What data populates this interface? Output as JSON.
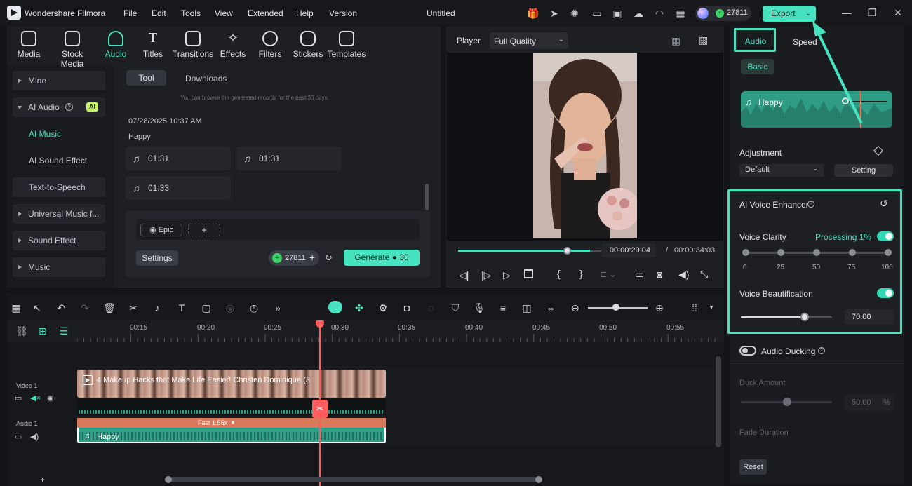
{
  "app": {
    "title": "Wondershare Filmora",
    "doc_title": "Untitled"
  },
  "menu": [
    "File",
    "Edit",
    "Tools",
    "View",
    "Extended",
    "Help",
    "Version"
  ],
  "credits": "27811",
  "export_label": "Export",
  "toolbar": [
    "Media",
    "Stock Media",
    "Audio",
    "Titles",
    "Transitions",
    "Effects",
    "Filters",
    "Stickers",
    "Templates"
  ],
  "sidebar": {
    "mine": "Mine",
    "ai_audio": "AI Audio",
    "ai_badge": "AI",
    "ai_music": "AI Music",
    "ai_sfx": "AI Sound Effect",
    "tts": "Text-to-Speech",
    "universal": "Universal Music f...",
    "sound_effect": "Sound Effect",
    "music": "Music"
  },
  "library": {
    "tab_tool": "Tool",
    "tab_downloads": "Downloads",
    "note": "You can browse the generated records for the past 30 days.",
    "date": "07/28/2025 10:37 AM",
    "group": "Happy",
    "tracks": [
      "01:31",
      "01:31",
      "01:33"
    ],
    "tag_epic": "Epic",
    "tag_add": "+",
    "settings": "Settings",
    "credits": "27811",
    "generate": "Generate",
    "generate_cost": "30"
  },
  "player": {
    "label": "Player",
    "quality": "Full Quality",
    "current": "00:00:29:04",
    "sep": "/",
    "total": "00:00:34:03",
    "progress": 0.86
  },
  "props": {
    "tab_audio": "Audio",
    "tab_speed": "Speed",
    "basic": "Basic",
    "clip_name": "Happy",
    "adjustment": "Adjustment",
    "preset": "Default",
    "setting": "Setting",
    "enhancer_title": "AI Voice Enhancer",
    "voice_clarity": "Voice Clarity",
    "processing": "Processing 1%",
    "clarity_ticks": [
      "0",
      "25",
      "50",
      "75",
      "100"
    ],
    "voice_beautification": "Voice Beautification",
    "beautification_value": "70.00",
    "beautification_level": 0.7,
    "audio_ducking": "Audio Ducking",
    "duck_amount": "Duck Amount",
    "duck_value": "50.00",
    "duck_unit": "%",
    "fade_duration": "Fade Duration",
    "reset": "Reset"
  },
  "timeline": {
    "ruler": [
      "00:15",
      "00:20",
      "00:25",
      "00:30",
      "00:35",
      "00:40",
      "00:45",
      "00:50",
      "00:55"
    ],
    "video_track": "Video 1",
    "audio_track": "Audio 1",
    "video_clip": "4 Makeup Hacks that Make Life Easier! Christen Dominique (3",
    "speed_label": "Fast 1.55x",
    "audio_clip": "Happy",
    "add": "+"
  },
  "colors": {
    "accent": "#4fe0c2",
    "highlight": "#47e3c0",
    "playhead": "#ff5d5d",
    "audio_clip": "#2e9f86",
    "speed_bar": "#d9785a"
  }
}
